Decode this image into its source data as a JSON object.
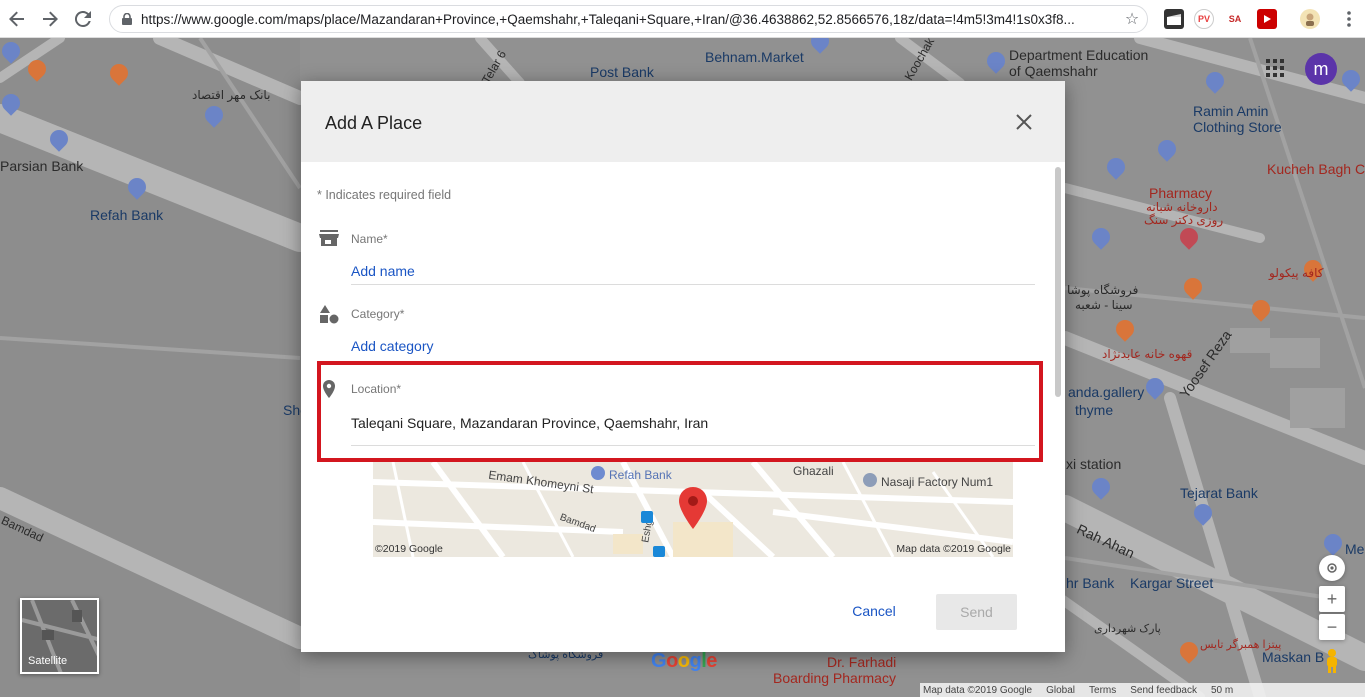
{
  "browser": {
    "url": "https://www.google.com/maps/place/Mazandaran+Province,+Qaemshahr,+Taleqani+Square,+Iran/@36.4638862,52.8566576,18z/data=!4m5!3m4!1s0x3f8...",
    "extensions": [
      {
        "name": "clapper-extension",
        "text": "",
        "color": "#333333"
      },
      {
        "name": "pixel-extension",
        "text": "PV",
        "color": "#ffffff"
      },
      {
        "name": "sa-extension",
        "text": "SA",
        "color": "#ffffff"
      },
      {
        "name": "youtube-extension",
        "text": "",
        "color": "#cc0000"
      }
    ]
  },
  "map": {
    "labels": [
      {
        "text": "Parsian Bank",
        "cls": "dark"
      },
      {
        "text": "Refah Bank",
        "cls": ""
      },
      {
        "text": "بانک مهر اقتصاد",
        "cls": "dark"
      },
      {
        "text": "Post Bank",
        "cls": ""
      },
      {
        "text": "Behnam.Market",
        "cls": ""
      },
      {
        "text": "Telar 6",
        "cls": "dark"
      },
      {
        "text": "Koochak",
        "cls": "dark"
      },
      {
        "text": "Department Education",
        "cls": "dark"
      },
      {
        "text": "of Qaemshahr",
        "cls": "dark"
      },
      {
        "text": "Ramin Amin",
        "cls": ""
      },
      {
        "text": "Clothing Store",
        "cls": ""
      },
      {
        "text": "Kucheh Bagh Ca",
        "cls": "red"
      },
      {
        "text": "Pharmacy",
        "cls": "red"
      },
      {
        "text": "داروخانه شبانه",
        "cls": "red"
      },
      {
        "text": "روزی دکتر سنگ",
        "cls": "red"
      },
      {
        "text": "فروشگاه پوشا",
        "cls": "dark"
      },
      {
        "text": "سینا - شعبه",
        "cls": "dark"
      },
      {
        "text": "قهوه خانه عابدنژاد",
        "cls": "red"
      },
      {
        "text": "کافه پیکولو",
        "cls": "red"
      },
      {
        "text": "Yoosef Reza",
        "cls": "dark"
      },
      {
        "text": "anda.gallery",
        "cls": ""
      },
      {
        "text": "thyme",
        "cls": ""
      },
      {
        "text": "xi station",
        "cls": "dark"
      },
      {
        "text": "Tejarat Bank",
        "cls": ""
      },
      {
        "text": "Rah Ahan",
        "cls": "dark"
      },
      {
        "text": "Kargar Street",
        "cls": ""
      },
      {
        "text": "hr Bank",
        "cls": ""
      },
      {
        "text": "Maskan B",
        "cls": ""
      },
      {
        "text": "Dr. Farhadi",
        "cls": "red"
      },
      {
        "text": "Boarding Pharmacy",
        "cls": "red"
      },
      {
        "text": "پارک شهرداری",
        "cls": "dark"
      },
      {
        "text": "پیتزا همبرگر تایس",
        "cls": "red"
      },
      {
        "text": "فروشگاه پوشاک",
        "cls": ""
      },
      {
        "text": "Bamdad",
        "cls": "dark"
      },
      {
        "text": "She",
        "cls": ""
      },
      {
        "text": "Me",
        "cls": ""
      }
    ],
    "avatar_letter": "m",
    "satellite_label": "Satellite",
    "zoom_in": "+",
    "zoom_out": "−",
    "footer": [
      "Map data ©2019 Google",
      "Global",
      "Terms",
      "Send feedback",
      "50 m"
    ],
    "google_logo": "Google"
  },
  "dialog": {
    "title": "Add A Place",
    "required_note": "* Indicates required field",
    "name_label": "Name*",
    "name_placeholder": "Add name",
    "category_label": "Category*",
    "category_placeholder": "Add category",
    "location_label": "Location*",
    "location_value": "Taleqani Square, Mazandaran Province, Qaemshahr, Iran",
    "mini_map": {
      "labels": [
        "Emam Khomeyni St",
        "Refah Bank",
        "Ghazali",
        "Nasaji Factory Num1",
        "Bamdad",
        "Eshghi"
      ],
      "copyright_left": "©2019 Google",
      "copyright_right": "Map data ©2019 Google"
    },
    "cancel_label": "Cancel",
    "send_label": "Send"
  }
}
